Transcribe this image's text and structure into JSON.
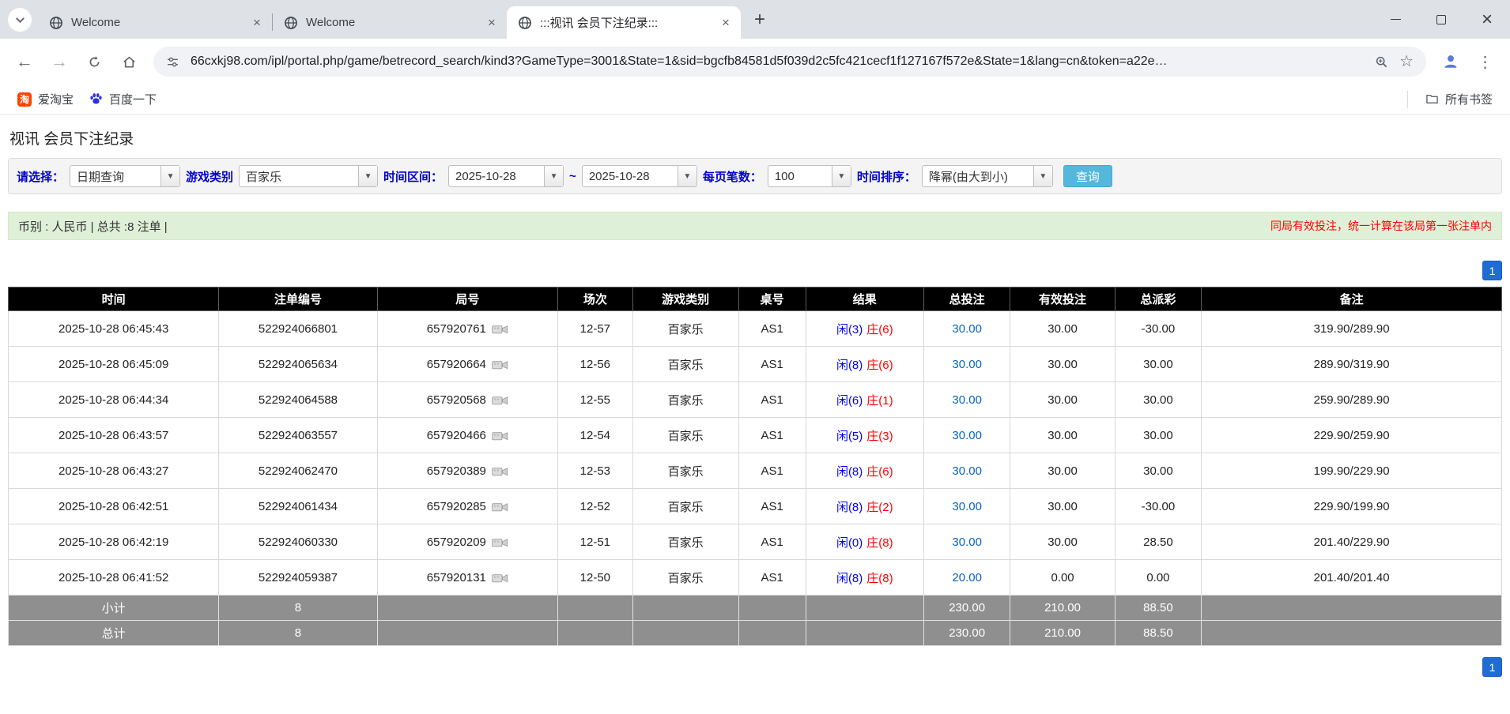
{
  "glyphs": {
    "new_tab": "+",
    "tab_close": "×",
    "back": "←",
    "forward": "→",
    "star": "☆",
    "menu": "⋮",
    "window_close": "×",
    "combo_arrow": "▼"
  },
  "colors": {
    "label_blue": "#0000cd",
    "search_button_blue": "#54b8dc",
    "pager_blue": "#1f6cd5",
    "player_blue": "#0000ff",
    "banker_red": "#ff0000",
    "link_blue": "#0663c8",
    "negative_red": "#e60000",
    "green_bar_bg": "#dff0d8",
    "table_header_bg": "#000000",
    "table_footer_bg": "#8f8f8f"
  },
  "browser": {
    "tabs": [
      {
        "title": "Welcome"
      },
      {
        "title": "Welcome"
      },
      {
        "title": ":::视讯 会员下注纪录:::"
      }
    ],
    "url": "66cxkj98.com/ipl/portal.php/game/betrecord_search/kind3?GameType=3001&State=1&sid=bgcfb84581d5f039d2c5fc421cecf1f127167f572e&State=1&lang=cn&token=a22e…",
    "bookmarks": {
      "taobao_label": "爱淘宝",
      "taobao_glyph": "淘",
      "baidu_label": "百度一下",
      "all_bookmarks_label": "所有书签"
    }
  },
  "page": {
    "title": "视讯 会员下注纪录",
    "filters": {
      "select_label": "请选择：",
      "select_value": "日期查询",
      "game_label": "游戏类别",
      "game_value": "百家乐",
      "range_label": "时间区间：",
      "date_from": "2025-10-28",
      "tilde": "~",
      "date_to": "2025-10-28",
      "per_page_label": "每页笔数：",
      "per_page_value": "100",
      "sort_label": "时间排序：",
      "sort_value": "降幂(由大到小)",
      "search_button": "查询"
    },
    "summary": {
      "left": "币别 : 人民币 | 总共 :8 注单 |",
      "right": "同局有效投注，统一计算在该局第一张注单内"
    },
    "pagination": {
      "page": "1"
    },
    "table": {
      "headers": [
        "时间",
        "注单编号",
        "局号",
        "场次",
        "游戏类别",
        "桌号",
        "结果",
        "总投注",
        "有效投注",
        "总派彩",
        "备注"
      ],
      "rows": [
        {
          "time": "2025-10-28 06:45:43",
          "bet_id": "522924066801",
          "round": "657920761",
          "session": "12-57",
          "game": "百家乐",
          "table_no": "AS1",
          "player": "闲(3)",
          "banker": "庄(6)",
          "total_bet": "30.00",
          "valid_bet": "30.00",
          "payout": "-30.00",
          "note": "319.90/289.90"
        },
        {
          "time": "2025-10-28 06:45:09",
          "bet_id": "522924065634",
          "round": "657920664",
          "session": "12-56",
          "game": "百家乐",
          "table_no": "AS1",
          "player": "闲(8)",
          "banker": "庄(6)",
          "total_bet": "30.00",
          "valid_bet": "30.00",
          "payout": "30.00",
          "note": "289.90/319.90"
        },
        {
          "time": "2025-10-28 06:44:34",
          "bet_id": "522924064588",
          "round": "657920568",
          "session": "12-55",
          "game": "百家乐",
          "table_no": "AS1",
          "player": "闲(6)",
          "banker": "庄(1)",
          "total_bet": "30.00",
          "valid_bet": "30.00",
          "payout": "30.00",
          "note": "259.90/289.90"
        },
        {
          "time": "2025-10-28 06:43:57",
          "bet_id": "522924063557",
          "round": "657920466",
          "session": "12-54",
          "game": "百家乐",
          "table_no": "AS1",
          "player": "闲(5)",
          "banker": "庄(3)",
          "total_bet": "30.00",
          "valid_bet": "30.00",
          "payout": "30.00",
          "note": "229.90/259.90"
        },
        {
          "time": "2025-10-28 06:43:27",
          "bet_id": "522924062470",
          "round": "657920389",
          "session": "12-53",
          "game": "百家乐",
          "table_no": "AS1",
          "player": "闲(8)",
          "banker": "庄(6)",
          "total_bet": "30.00",
          "valid_bet": "30.00",
          "payout": "30.00",
          "note": "199.90/229.90"
        },
        {
          "time": "2025-10-28 06:42:51",
          "bet_id": "522924061434",
          "round": "657920285",
          "session": "12-52",
          "game": "百家乐",
          "table_no": "AS1",
          "player": "闲(8)",
          "banker": "庄(2)",
          "total_bet": "30.00",
          "valid_bet": "30.00",
          "payout": "-30.00",
          "note": "229.90/199.90"
        },
        {
          "time": "2025-10-28 06:42:19",
          "bet_id": "522924060330",
          "round": "657920209",
          "session": "12-51",
          "game": "百家乐",
          "table_no": "AS1",
          "player": "闲(0)",
          "banker": "庄(8)",
          "total_bet": "30.00",
          "valid_bet": "30.00",
          "payout": "28.50",
          "note": "201.40/229.90"
        },
        {
          "time": "2025-10-28 06:41:52",
          "bet_id": "522924059387",
          "round": "657920131",
          "session": "12-50",
          "game": "百家乐",
          "table_no": "AS1",
          "player": "闲(8)",
          "banker": "庄(8)",
          "total_bet": "20.00",
          "valid_bet": "0.00",
          "payout": "0.00",
          "note": "201.40/201.40"
        }
      ],
      "subtotal": {
        "label": "小计",
        "count": "8",
        "total_bet": "230.00",
        "valid_bet": "210.00",
        "payout": "88.50"
      },
      "grand_total": {
        "label": "总计",
        "count": "8",
        "total_bet": "230.00",
        "valid_bet": "210.00",
        "payout": "88.50"
      }
    }
  }
}
